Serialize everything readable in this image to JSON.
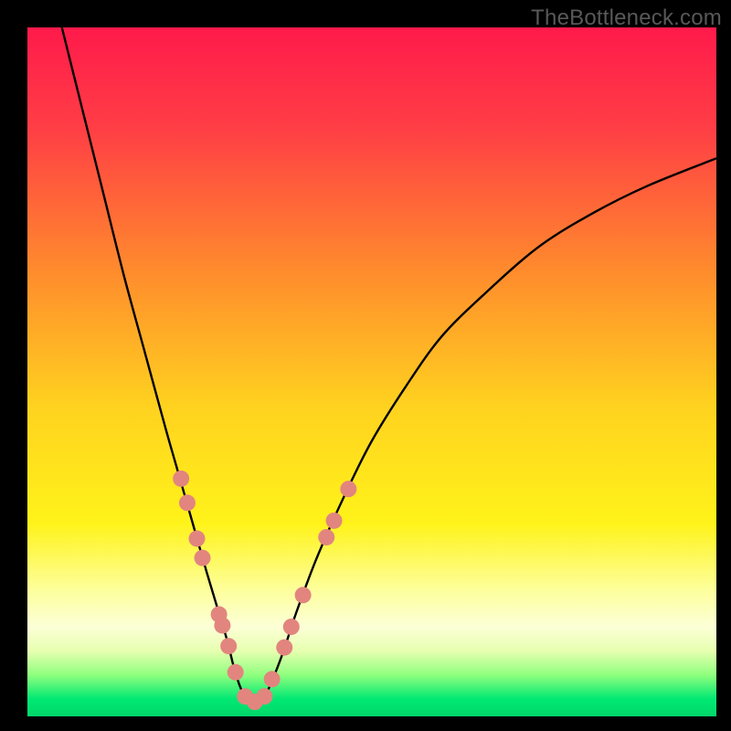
{
  "watermark": "TheBottleneck.com",
  "chart_data": {
    "type": "line",
    "title": "",
    "xlabel": "",
    "ylabel": "",
    "xlim": [
      0,
      100
    ],
    "ylim": [
      0,
      100
    ],
    "grid": false,
    "legend": false,
    "background_gradient": {
      "stops": [
        {
          "offset": 0.0,
          "color": "#ff1a4b"
        },
        {
          "offset": 0.15,
          "color": "#ff3f45"
        },
        {
          "offset": 0.35,
          "color": "#ff8a2d"
        },
        {
          "offset": 0.55,
          "color": "#ffd21f"
        },
        {
          "offset": 0.72,
          "color": "#fff31a"
        },
        {
          "offset": 0.82,
          "color": "#fdffa0"
        },
        {
          "offset": 0.87,
          "color": "#fcffd6"
        },
        {
          "offset": 0.905,
          "color": "#e7ffb0"
        },
        {
          "offset": 0.94,
          "color": "#8fff7e"
        },
        {
          "offset": 0.975,
          "color": "#00e873"
        },
        {
          "offset": 1.0,
          "color": "#00d76a"
        }
      ]
    },
    "series": [
      {
        "name": "bottleneck-curve",
        "color": "#000000",
        "x": [
          5,
          8,
          11,
          14,
          17,
          20,
          22,
          24,
          26,
          27.5,
          29,
          30,
          31,
          32,
          33,
          34,
          35,
          37,
          39,
          42,
          46,
          50,
          55,
          60,
          66,
          74,
          82,
          90,
          100
        ],
        "y": [
          100,
          88,
          76,
          64,
          53,
          42,
          35,
          28,
          21,
          16,
          11,
          7,
          4,
          2.5,
          2,
          2.5,
          4,
          9,
          15,
          23,
          32,
          40,
          48,
          55,
          61,
          68,
          73,
          77,
          81
        ]
      }
    ],
    "markers": {
      "name": "highlight-dots",
      "color": "#e2857f",
      "radius": 9,
      "points": [
        {
          "x": 22.3,
          "y": 34.5
        },
        {
          "x": 23.2,
          "y": 31.0
        },
        {
          "x": 24.6,
          "y": 25.8
        },
        {
          "x": 25.4,
          "y": 23.0
        },
        {
          "x": 27.8,
          "y": 14.8
        },
        {
          "x": 28.3,
          "y": 13.2
        },
        {
          "x": 29.2,
          "y": 10.2
        },
        {
          "x": 30.2,
          "y": 6.4
        },
        {
          "x": 31.6,
          "y": 2.9
        },
        {
          "x": 33.0,
          "y": 2.1
        },
        {
          "x": 34.4,
          "y": 2.9
        },
        {
          "x": 35.5,
          "y": 5.4
        },
        {
          "x": 37.3,
          "y": 10.0
        },
        {
          "x": 38.3,
          "y": 13.0
        },
        {
          "x": 40.0,
          "y": 17.6
        },
        {
          "x": 43.4,
          "y": 26.0
        },
        {
          "x": 44.5,
          "y": 28.4
        },
        {
          "x": 46.6,
          "y": 33.0
        }
      ]
    }
  }
}
